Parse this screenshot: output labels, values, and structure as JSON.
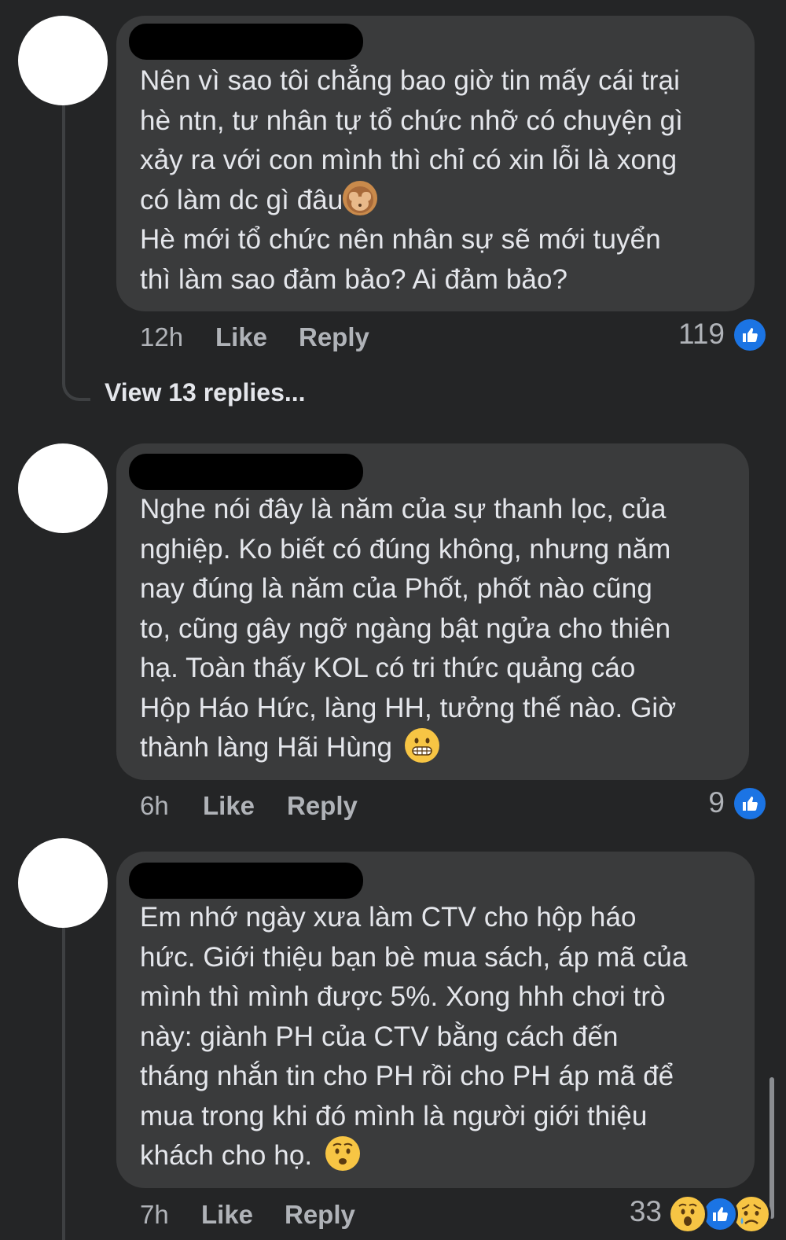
{
  "comments": [
    {
      "text": "Nên vì sao tôi chẳng bao giờ tin mấy cái trại\nhè ntn, tư nhân tự tổ chức nhỡ có chuyện gì\nxảy ra với con mình thì chỉ có xin lỗi là xong\ncó làm dc gì đâu",
      "text2": "Hè mới tổ chức nên nhân sự sẽ mới tuyển\nthì làm sao đảm bảo? Ai đảm bảo?",
      "emoji": "see-no-evil-monkey",
      "time": "12h",
      "like_label": "Like",
      "reply_label": "Reply",
      "reaction_count": "119",
      "reactions": [
        "like"
      ],
      "view_replies": "View 13 replies..."
    },
    {
      "text": "Nghe nói đây là năm của sự thanh lọc, của\nnghiệp. Ko biết có đúng không, nhưng năm\nnay đúng là năm của Phốt, phốt nào cũng\nto, cũng gây ngỡ ngàng bật ngửa cho thiên\nhạ. Toàn thấy KOL có tri thức quảng cáo\nHộp Háo Hức, làng HH, tưởng thế nào. Giờ\nthành làng Hãi Hùng",
      "emoji": "grimacing-face",
      "time": "6h",
      "like_label": "Like",
      "reply_label": "Reply",
      "reaction_count": "9",
      "reactions": [
        "like"
      ]
    },
    {
      "text": "Em nhớ ngày xưa làm CTV cho hộp háo\nhức. Giới thiệu bạn bè mua sách, áp mã của\nmình thì mình được 5%. Xong hhh chơi trò\nnày: giành PH của CTV bằng cách đến\ntháng nhắn tin cho PH rồi cho PH áp mã để\nmua trong khi đó mình là người giới thiệu\nkhách cho họ.",
      "emoji": "hushed-face",
      "time": "7h",
      "like_label": "Like",
      "reply_label": "Reply",
      "reaction_count": "33",
      "reactions": [
        "wow",
        "like",
        "sad"
      ]
    }
  ],
  "colors": {
    "background": "#242526",
    "bubble": "#3a3b3c",
    "text": "#e4e6eb",
    "meta": "#b0b3b8",
    "like_blue": "#1b74e4",
    "emoji_yellow": "#f7c544"
  }
}
